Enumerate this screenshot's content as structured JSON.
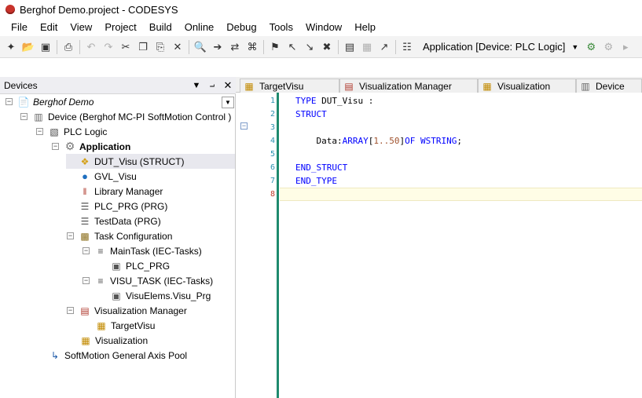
{
  "window": {
    "title": "Berghof Demo.project - CODESYS"
  },
  "menu": [
    "File",
    "Edit",
    "View",
    "Project",
    "Build",
    "Online",
    "Debug",
    "Tools",
    "Window",
    "Help"
  ],
  "toolbar": {
    "application_selector": "Application [Device: PLC Logic]"
  },
  "devices_panel": {
    "title": "Devices",
    "tree": [
      {
        "label": "Berghof Demo",
        "icon": "project-icon",
        "italic": true,
        "expander": "-"
      },
      {
        "label": "Device (Berghof MC-PI SoftMotion Control )",
        "icon": "device-icon",
        "expander": "-"
      },
      {
        "label": "PLC Logic",
        "icon": "plc-logic-icon",
        "expander": "-"
      },
      {
        "label": "Application",
        "icon": "application-gear-icon",
        "bold": true,
        "expander": "-"
      },
      {
        "label": "DUT_Visu (STRUCT)",
        "icon": "dut-icon",
        "selected": true
      },
      {
        "label": "GVL_Visu",
        "icon": "gvl-globe-icon"
      },
      {
        "label": "Library Manager",
        "icon": "library-manager-icon"
      },
      {
        "label": "PLC_PRG (PRG)",
        "icon": "pou-icon"
      },
      {
        "label": "TestData (PRG)",
        "icon": "pou-icon"
      },
      {
        "label": "Task Configuration",
        "icon": "task-configuration-icon",
        "expander": "-"
      },
      {
        "label": "MainTask (IEC-Tasks)",
        "icon": "task-icon",
        "expander": "-"
      },
      {
        "label": "PLC_PRG",
        "icon": "program-call-icon"
      },
      {
        "label": "VISU_TASK (IEC-Tasks)",
        "icon": "task-icon",
        "expander": "-"
      },
      {
        "label": "VisuElems.Visu_Prg",
        "icon": "program-call-icon"
      },
      {
        "label": "Visualization Manager",
        "icon": "visualization-manager-icon",
        "expander": "-"
      },
      {
        "label": "TargetVisu",
        "icon": "target-visu-icon"
      },
      {
        "label": "Visualization",
        "icon": "visualization-icon"
      },
      {
        "label": "SoftMotion General Axis Pool",
        "icon": "axis-pool-icon"
      }
    ]
  },
  "tabs": [
    {
      "label": "TargetVisu",
      "icon": "target-visu-icon",
      "active": false
    },
    {
      "label": "Visualization Manager",
      "icon": "visualization-manager-icon",
      "active": false
    },
    {
      "label": "Visualization",
      "icon": "visualization-icon",
      "active": false
    },
    {
      "label": "Device",
      "icon": "device-icon",
      "active": false
    }
  ],
  "editor": {
    "line_numbers": [
      "1",
      "2",
      "3",
      "4",
      "5",
      "6",
      "7",
      "8"
    ],
    "lines": [
      {
        "parts": [
          {
            "t": "TYPE",
            "c": "kw"
          },
          {
            "t": " DUT_Visu :",
            "c": "ident"
          }
        ]
      },
      {
        "parts": [
          {
            "t": "STRUCT",
            "c": "kw"
          }
        ]
      },
      {
        "parts": []
      },
      {
        "parts": [
          {
            "t": "    Data:",
            "c": "ident"
          },
          {
            "t": "ARRAY",
            "c": "kw"
          },
          {
            "t": "[",
            "c": "ident"
          },
          {
            "t": "1..50",
            "c": "num"
          },
          {
            "t": "]",
            "c": "ident"
          },
          {
            "t": "OF",
            "c": "kw"
          },
          {
            "t": " ",
            "c": "ident"
          },
          {
            "t": "WSTRING",
            "c": "kw"
          },
          {
            "t": ";",
            "c": "ident"
          }
        ]
      },
      {
        "parts": []
      },
      {
        "parts": [
          {
            "t": "END_STRUCT",
            "c": "kw"
          }
        ]
      },
      {
        "parts": [
          {
            "t": "END_TYPE",
            "c": "kw"
          }
        ]
      },
      {
        "parts": []
      }
    ],
    "current_line": 8
  },
  "colors": {
    "accent_green": "#1e8a6e",
    "keyword_blue": "#0000ff",
    "line_number": "#2b91af"
  }
}
